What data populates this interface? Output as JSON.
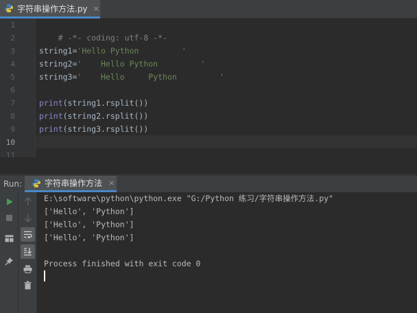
{
  "editor_tab": {
    "label": "字符串操作方法.py",
    "close": "×"
  },
  "code": {
    "line_numbers": [
      "1",
      "2",
      "3",
      "4",
      "5",
      "6",
      "7",
      "8",
      "9",
      "10",
      "11"
    ],
    "line1": "# -*- coding: utf-8 -*-",
    "line3": {
      "var": "string1=",
      "str": "'Hello Python         '"
    },
    "line4": {
      "var": "string2=",
      "str": "'    Hello Python         '"
    },
    "line5": {
      "var": "string3=",
      "str": "'    Hello     Python         '"
    },
    "line7": {
      "fn": "print",
      "args": "(string1.rsplit())"
    },
    "line8": {
      "fn": "print",
      "args": "(string2.rsplit())"
    },
    "line9": {
      "fn": "print",
      "args": "(string3.rsplit())"
    },
    "current_line": "10"
  },
  "run": {
    "title": "Run:",
    "tab_label": "字符串操作方法",
    "tab_close": "×",
    "console_lines": [
      "E:\\software\\python\\python.exe \"G:/Python 练习/字符串操作方法.py\"",
      "['Hello', 'Python']",
      "['Hello', 'Python']",
      "['Hello', 'Python']",
      "Process finished with exit code 0"
    ]
  },
  "colors": {
    "editor_bg": "#2b2b2b",
    "panel_bg": "#3c3f41",
    "accent": "#4a88c7",
    "string": "#6a8759",
    "builtin": "#8888c6",
    "comment": "#808080",
    "run_green": "#499c54"
  },
  "icons": [
    "python-file-icon",
    "run-icon",
    "stop-icon",
    "layout-icon",
    "pin-icon",
    "up-arrow-icon",
    "down-arrow-icon",
    "soft-wrap-icon",
    "scroll-to-end-icon",
    "print-icon",
    "trash-icon"
  ]
}
